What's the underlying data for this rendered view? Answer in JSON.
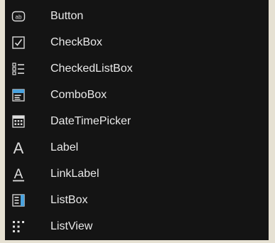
{
  "toolbox": {
    "items": [
      {
        "label": "Button",
        "icon": "button-icon"
      },
      {
        "label": "CheckBox",
        "icon": "checkbox-icon"
      },
      {
        "label": "CheckedListBox",
        "icon": "checked-list-box-icon"
      },
      {
        "label": "ComboBox",
        "icon": "combo-box-icon"
      },
      {
        "label": "DateTimePicker",
        "icon": "date-time-picker-icon"
      },
      {
        "label": "Label",
        "icon": "label-icon"
      },
      {
        "label": "LinkLabel",
        "icon": "link-label-icon"
      },
      {
        "label": "ListBox",
        "icon": "list-box-icon"
      },
      {
        "label": "ListView",
        "icon": "list-view-icon"
      }
    ],
    "button_icon_text": "ab",
    "label_icon_text": "A",
    "colors": {
      "panel": "#141414",
      "text": "#e9e9e9",
      "icon": "#dcdcdc",
      "accent": "#4aa3df"
    }
  }
}
